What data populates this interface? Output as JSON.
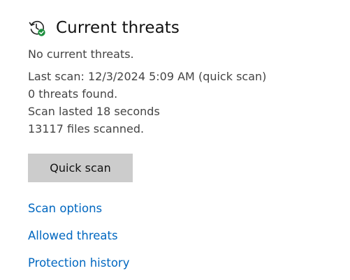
{
  "section": {
    "title": "Current threats",
    "icon": "scan-clock-check-icon",
    "accent_check_color": "#1e8e3e"
  },
  "status": {
    "text": "No current threats."
  },
  "scan_info": {
    "last_scan": "Last scan: 12/3/2024 5:09 AM (quick scan)",
    "threats_found": "0 threats found.",
    "duration": "Scan lasted 18 seconds",
    "files_scanned": "13117 files scanned."
  },
  "actions": {
    "quick_scan_label": "Quick scan"
  },
  "links": {
    "scan_options": "Scan options",
    "allowed_threats": "Allowed threats",
    "protection_history": "Protection history",
    "color": "#0067c0"
  }
}
